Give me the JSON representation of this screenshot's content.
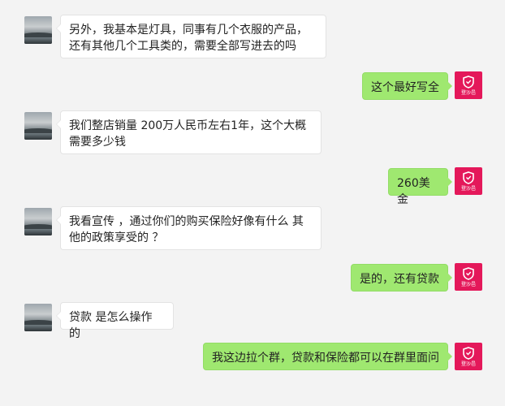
{
  "colors": {
    "background": "#f3f3f3",
    "incoming_bubble": "#ffffff",
    "outgoing_bubble": "#9fe870",
    "my_avatar_bg": "#e4185a"
  },
  "my_avatar": {
    "icon": "shield-icon",
    "brand_text": "登沙邑"
  },
  "contact_avatar": {
    "icon": "landscape-photo"
  },
  "messages": [
    {
      "side": "in",
      "text": "另外，我基本是灯具，同事有几个衣服的产品，还有其他几个工具类的，需要全部写进去的吗"
    },
    {
      "side": "out",
      "text": "这个最好写全"
    },
    {
      "side": "in",
      "text": "我们整店销量 200万人民币左右1年，这个大概需要多少钱"
    },
    {
      "side": "out",
      "text": "260美金"
    },
    {
      "side": "in",
      "text": "我看宣传 ，通过你们的购买保险好像有什么 其他的政策享受的 ？"
    },
    {
      "side": "out",
      "text": "是的，还有贷款"
    },
    {
      "side": "in",
      "text": "贷款 是怎么操作 的"
    },
    {
      "side": "out",
      "text": "我这边拉个群，贷款和保险都可以在群里面问"
    }
  ]
}
